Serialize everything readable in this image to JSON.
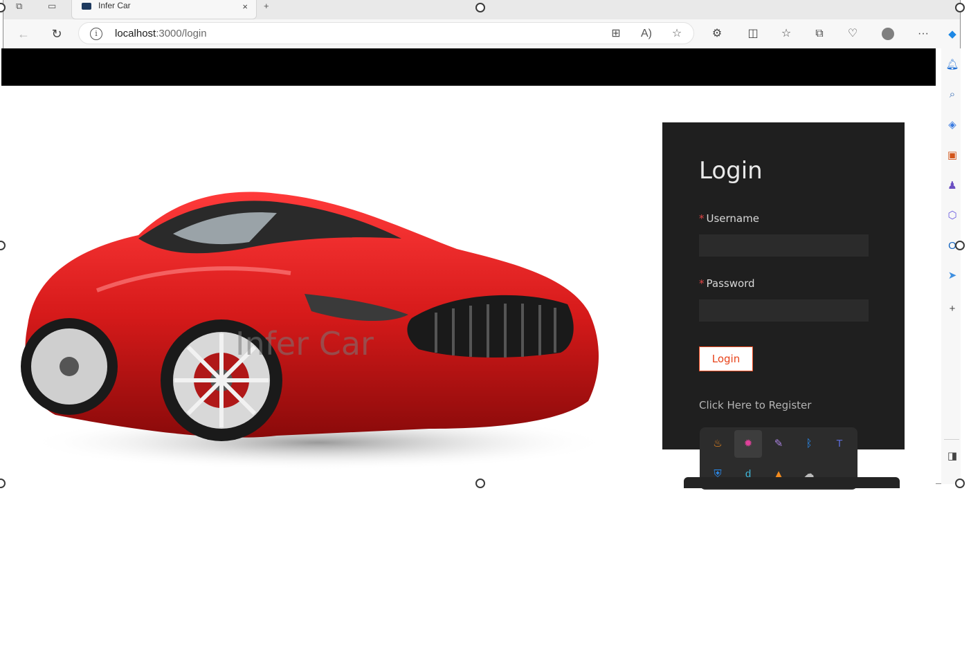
{
  "browser": {
    "tab_title": "Infer Car",
    "tab_close": "×",
    "new_tab": "+",
    "url_host": "localhost",
    "url_path": ":3000/login",
    "more_label": "···"
  },
  "page": {
    "brand_watermark": "Infer Car",
    "login": {
      "title": "Login",
      "username_label": "Username",
      "password_label": "Password",
      "required_mark": "*",
      "username_value": "",
      "password_value": "",
      "submit_label": "Login",
      "register_link": "Click Here to Register"
    }
  },
  "colors": {
    "topbar": "#000000",
    "panel": "#1f1f1f",
    "accent": "#e8431a",
    "required": "#e04545",
    "car_red": "#d61a1a"
  },
  "tray_icons": [
    "java-icon",
    "flame-app-icon",
    "feather-icon",
    "bluetooth-icon",
    "teams-icon",
    "defender-icon",
    "d-app-icon",
    "matlab-icon",
    "onedrive-icon"
  ],
  "sidebar_icons": [
    "bell-icon",
    "search-icon",
    "tag-icon",
    "briefcase-icon",
    "chess-icon",
    "office-icon",
    "outlook-icon",
    "send-icon",
    "add-icon",
    "split-pane-icon"
  ]
}
